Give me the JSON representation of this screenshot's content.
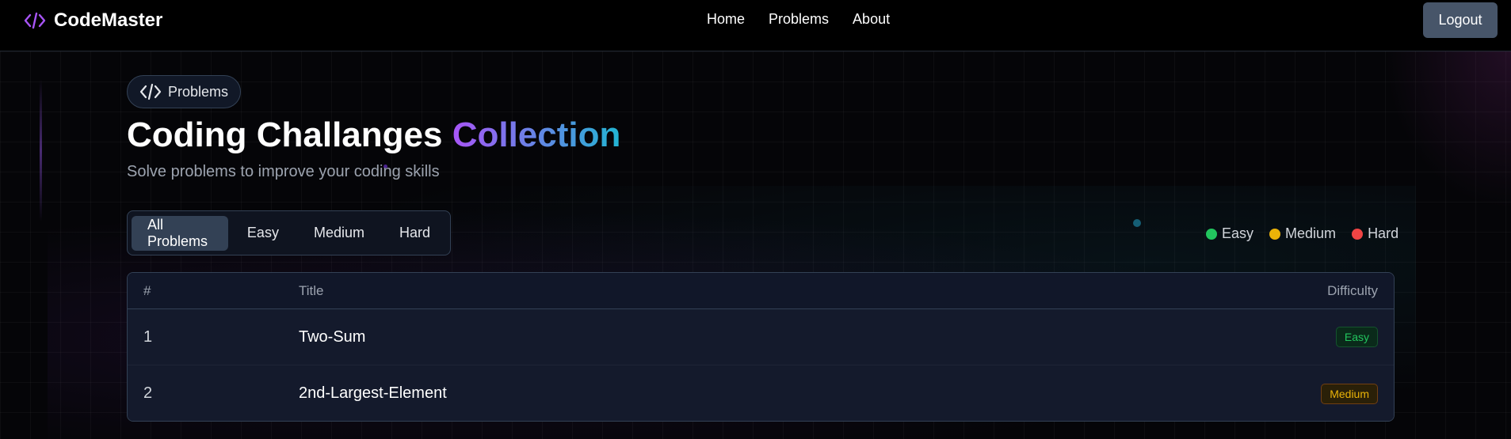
{
  "navbar": {
    "brand": "CodeMaster",
    "brand_icon": "code-icon",
    "links": [
      "Home",
      "Problems",
      "About"
    ],
    "logout_label": "Logout"
  },
  "header": {
    "pill_label": "Problems",
    "pill_icon": "code-icon",
    "title_main": "Coding Challanges ",
    "title_accent": "Collection",
    "subtitle": "Solve problems to improve your coding skills"
  },
  "filters": {
    "tabs": [
      "All Problems",
      "Easy",
      "Medium",
      "Hard"
    ],
    "active": "All Problems"
  },
  "legend": [
    {
      "label": "Easy",
      "color": "#22c55e"
    },
    {
      "label": "Medium",
      "color": "#eab308"
    },
    {
      "label": "Hard",
      "color": "#ef4444"
    }
  ],
  "table": {
    "headers": {
      "num": "#",
      "title": "Title",
      "difficulty": "Difficulty"
    },
    "rows": [
      {
        "num": "1",
        "title": "Two-Sum",
        "difficulty": "Easy"
      },
      {
        "num": "2",
        "title": "2nd-Largest-Element",
        "difficulty": "Medium"
      }
    ]
  },
  "colors": {
    "accent_start": "#a855f7",
    "accent_end": "#22b5d3",
    "logout_bg": "#475569"
  }
}
